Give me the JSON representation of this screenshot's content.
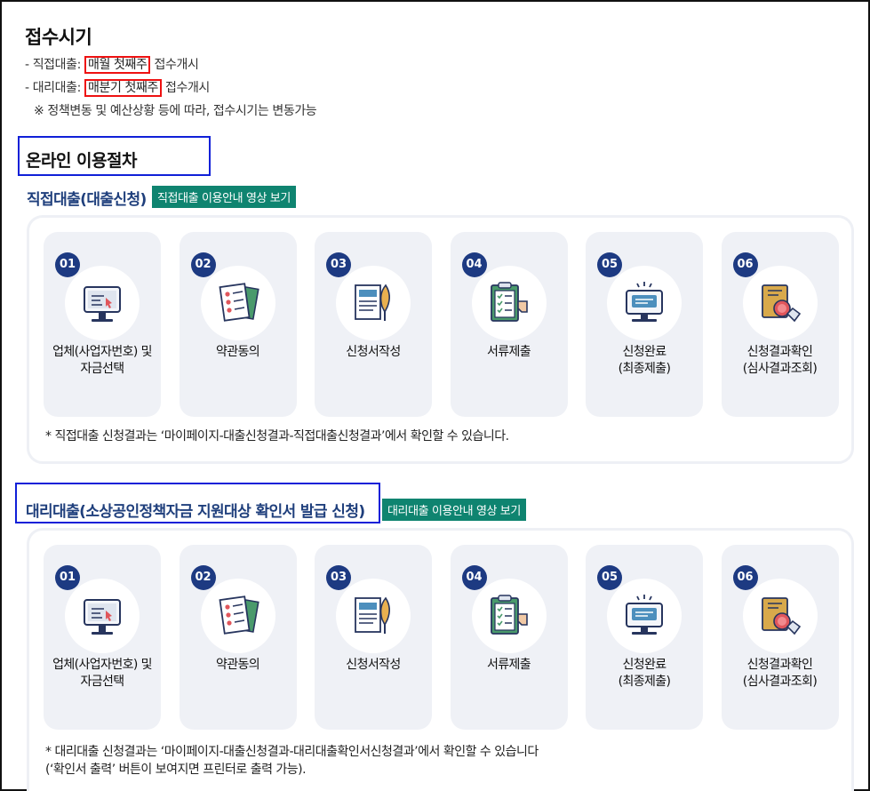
{
  "reception": {
    "title": "접수시기",
    "direct_prefix": "- 직접대출: ",
    "direct_highlight": "매월 첫째주",
    "direct_suffix": " 접수개시",
    "agent_prefix": "- 대리대출: ",
    "agent_highlight": "매분기 첫째주",
    "agent_suffix": " 접수개시",
    "note": "※ 정책변동 및 예산상황 등에 따라, 접수시기는 변동가능"
  },
  "online": {
    "title": "온라인 이용절차"
  },
  "direct": {
    "title": "직접대출(대출신청)",
    "video_button": "직접대출 이용안내 영상 보기",
    "steps": [
      {
        "num": "01",
        "label": "업체(사업자번호) 및\n자금선택",
        "icon": "computer-cursor-icon"
      },
      {
        "num": "02",
        "label": "약관동의",
        "icon": "checklist-documents-icon"
      },
      {
        "num": "03",
        "label": "신청서작성",
        "icon": "document-pen-icon"
      },
      {
        "num": "04",
        "label": "서류제출",
        "icon": "clipboard-hand-icon"
      },
      {
        "num": "05",
        "label": "신청완료\n(최종제출)",
        "icon": "monitor-message-icon"
      },
      {
        "num": "06",
        "label": "신청결과확인\n(심사결과조회)",
        "icon": "book-stamp-handshake-icon"
      }
    ],
    "footnote": "* 직접대출 신청결과는 ‘마이페이지-대출신청결과-직접대출신청결과’에서 확인할 수 있습니다."
  },
  "agent": {
    "title": "대리대출(소상공인정책자금 지원대상 확인서 발급 신청)",
    "video_button": "대리대출 이용안내 영상 보기",
    "steps": [
      {
        "num": "01",
        "label": "업체(사업자번호) 및\n자금선택",
        "icon": "computer-cursor-icon"
      },
      {
        "num": "02",
        "label": "약관동의",
        "icon": "checklist-documents-icon"
      },
      {
        "num": "03",
        "label": "신청서작성",
        "icon": "document-pen-icon"
      },
      {
        "num": "04",
        "label": "서류제출",
        "icon": "clipboard-hand-icon"
      },
      {
        "num": "05",
        "label": "신청완료\n(최종제출)",
        "icon": "monitor-message-icon"
      },
      {
        "num": "06",
        "label": "신청결과확인\n(심사결과조회)",
        "icon": "book-stamp-handshake-icon"
      }
    ],
    "footnote_line1": "* 대리대출 신청결과는 ‘마이페이지-대출신청결과-대리대출확인서신청결과’에서 확인할 수 있습니다",
    "footnote_line2": "(‘확인서 출력’ 버튼이 보여지면 프린터로 출력 가능)."
  },
  "colors": {
    "highlight_red": "#e11111",
    "focus_blue": "#1020d8",
    "title_navy": "#1f3f7c",
    "badge_navy": "#1d3a82",
    "video_button_green": "#0f8470",
    "card_bg": "#eff1f6"
  }
}
